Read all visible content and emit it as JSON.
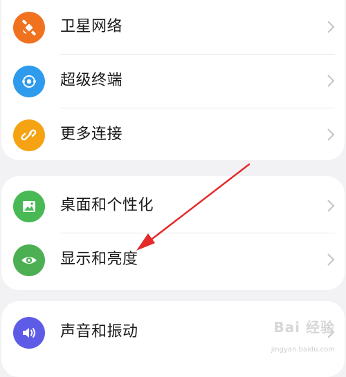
{
  "settings_groups": [
    {
      "items": [
        {
          "label": "卫星网络",
          "icon": "satellite-icon",
          "color": "#f0721f"
        },
        {
          "label": "超级终端",
          "icon": "super-device-icon",
          "color": "#2e9bec"
        },
        {
          "label": "更多连接",
          "icon": "link-icon",
          "color": "#f6a313"
        }
      ]
    },
    {
      "items": [
        {
          "label": "桌面和个性化",
          "icon": "picture-icon",
          "color": "#48b955"
        },
        {
          "label": "显示和亮度",
          "icon": "eye-icon",
          "color": "#4cb053"
        }
      ]
    },
    {
      "items": [
        {
          "label": "声音和振动",
          "icon": "speaker-icon",
          "color": "#5e5ce6"
        }
      ]
    }
  ],
  "annotation": {
    "arrow_color": "#e52a2a"
  },
  "watermark": {
    "logo_text": "Bai 经验",
    "url_text": "jingyan.baidu.com"
  }
}
